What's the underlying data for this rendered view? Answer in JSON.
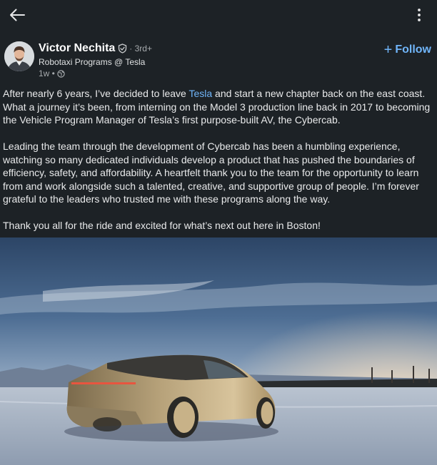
{
  "nav": {
    "back_icon": "arrow-left-icon",
    "more_icon": "more-vertical-icon"
  },
  "author": {
    "name": "Victor Nechita",
    "verified_icon": "verified-shield-icon",
    "degree": "· 3rd+",
    "headline": "Robotaxi Programs @ Tesla",
    "time": "1w •",
    "visibility_icon": "globe-icon"
  },
  "follow": {
    "plus": "+",
    "label": "Follow"
  },
  "post": {
    "p1_before": "After nearly 6 years, I’ve decided to leave ",
    "p1_mention": "Tesla",
    "p1_after": " and start a new chapter back on the east coast. What a journey it’s been, from interning on the Model 3 production line back in 2017 to becoming the Vehicle Program Manager of Tesla’s first purpose-built AV, the Cybercab.",
    "p2": "Leading the team through the development of Cybercab has been a humbling experience, watching so many dedicated individuals develop a product that has pushed the boundaries of efficiency, safety, and affordability. A heartfelt thank you to the team for the opportunity to learn from and work alongside such a talented, creative, and supportive group of people. I’m forever grateful to the leaders who trusted me with these programs along the way.",
    "p3": "Thank you all for the ride and excited for what’s next out here in Boston!"
  },
  "image": {
    "subject": "gold Cybercab on snowy road at dusk"
  },
  "colors": {
    "background": "#1d2226",
    "accent": "#70b5f9",
    "text": "#e9eaeb",
    "muted": "#a6aaad"
  }
}
